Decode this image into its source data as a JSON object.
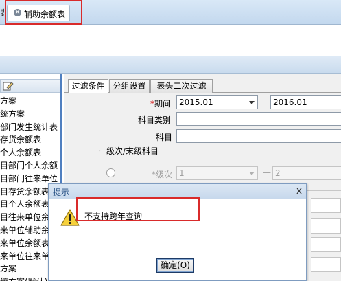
{
  "tabstrip": {
    "active_tab": {
      "label": "辅助余额表",
      "close_icon": "×"
    },
    "left_edge_text": "表"
  },
  "left_tree": {
    "toolbar_icon": "edit-icon",
    "items": [
      "方案",
      "统方案",
      "部门发生统计表",
      "存货余额表",
      "个人余额表",
      "目部门个人余额",
      "目部门往来单位",
      "目存货余额表",
      "目个人余额表",
      "目往来单位余",
      "来单位辅助余",
      "来单位余额表",
      "来单位往来单位",
      "方案",
      "统方案(默认)"
    ]
  },
  "filter": {
    "tabs": [
      "过滤条件",
      "分组设置",
      "表头二次过滤"
    ],
    "period": {
      "required_mark": "*",
      "label": "期间",
      "from": "2015.01",
      "dash": "—",
      "to": "2016.01"
    },
    "account_type_label": "科目类别",
    "account_label": "科目",
    "group_title": "级次/末级科目",
    "level": {
      "required_mark": "*",
      "label": "级次",
      "from": "1",
      "dash": "—",
      "to": "2"
    }
  },
  "dialog": {
    "title": "提示",
    "close_label": "x",
    "message": "不支持跨年查询",
    "ok_button": "确定(O)"
  }
}
